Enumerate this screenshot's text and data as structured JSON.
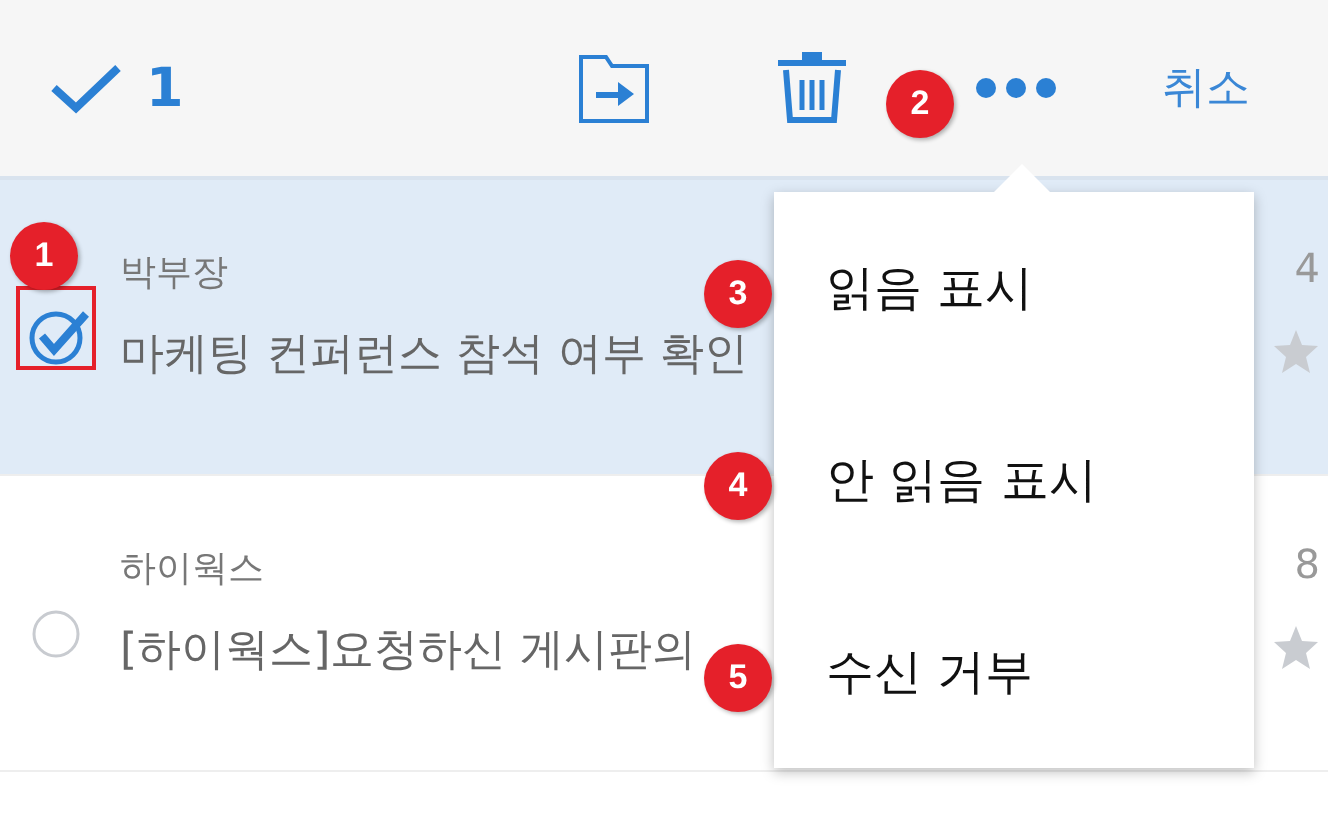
{
  "toolbar": {
    "selected_count": "1",
    "cancel": "취소"
  },
  "messages": [
    {
      "sender": "박부장",
      "subject": "마케팅 컨퍼런스 참석 여부 확인",
      "date": "4",
      "selected": true
    },
    {
      "sender": "하이웍스",
      "subject": "[하이웍스]요청하신 게시판의",
      "date": "8",
      "selected": false
    }
  ],
  "menu": {
    "items": [
      "읽음 표시",
      "안 읽음 표시",
      "수신 거부"
    ]
  },
  "annotations": [
    "1",
    "2",
    "3",
    "4",
    "5"
  ]
}
